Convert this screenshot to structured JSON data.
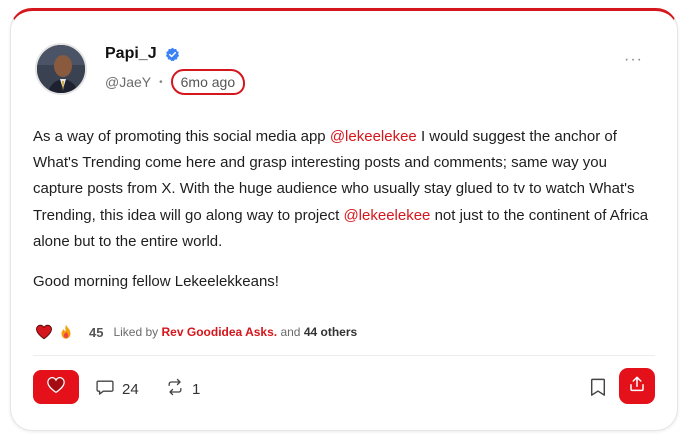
{
  "author": {
    "name": "Papi_J",
    "handle": "@JaeY",
    "separator": "•",
    "time_ago": "6mo ago",
    "more_label": "···"
  },
  "post": {
    "segments": [
      {
        "text": "As a way of promoting this social media app ",
        "mention": false
      },
      {
        "text": "@lekeelekee",
        "mention": true
      },
      {
        "text": " I would suggest the anchor of What's Trending come here and grasp interesting posts and comments; same way you capture posts from X. With the huge audience who usually stay glued to tv to watch What's Trending, this idea will go along way to project ",
        "mention": false
      },
      {
        "text": "@lekeelekee",
        "mention": true
      },
      {
        "text": " not just to the continent of Africa alone but to the entire world.",
        "mention": false
      }
    ],
    "greeting": "Good morning fellow Lekeelekkeans!"
  },
  "reactions": {
    "icons": [
      "heart-eyes-emoji",
      "fire-emoji"
    ],
    "count": "45",
    "liked_by_prefix": "Liked by",
    "liked_by_name": "Rev Goodidea Asks.",
    "liked_by_and": "and",
    "liked_by_others": "44 others"
  },
  "actions": {
    "comments_count": "24",
    "reposts_count": "1"
  },
  "colors": {
    "accent": "#e4111b",
    "mention": "#d5161c"
  }
}
